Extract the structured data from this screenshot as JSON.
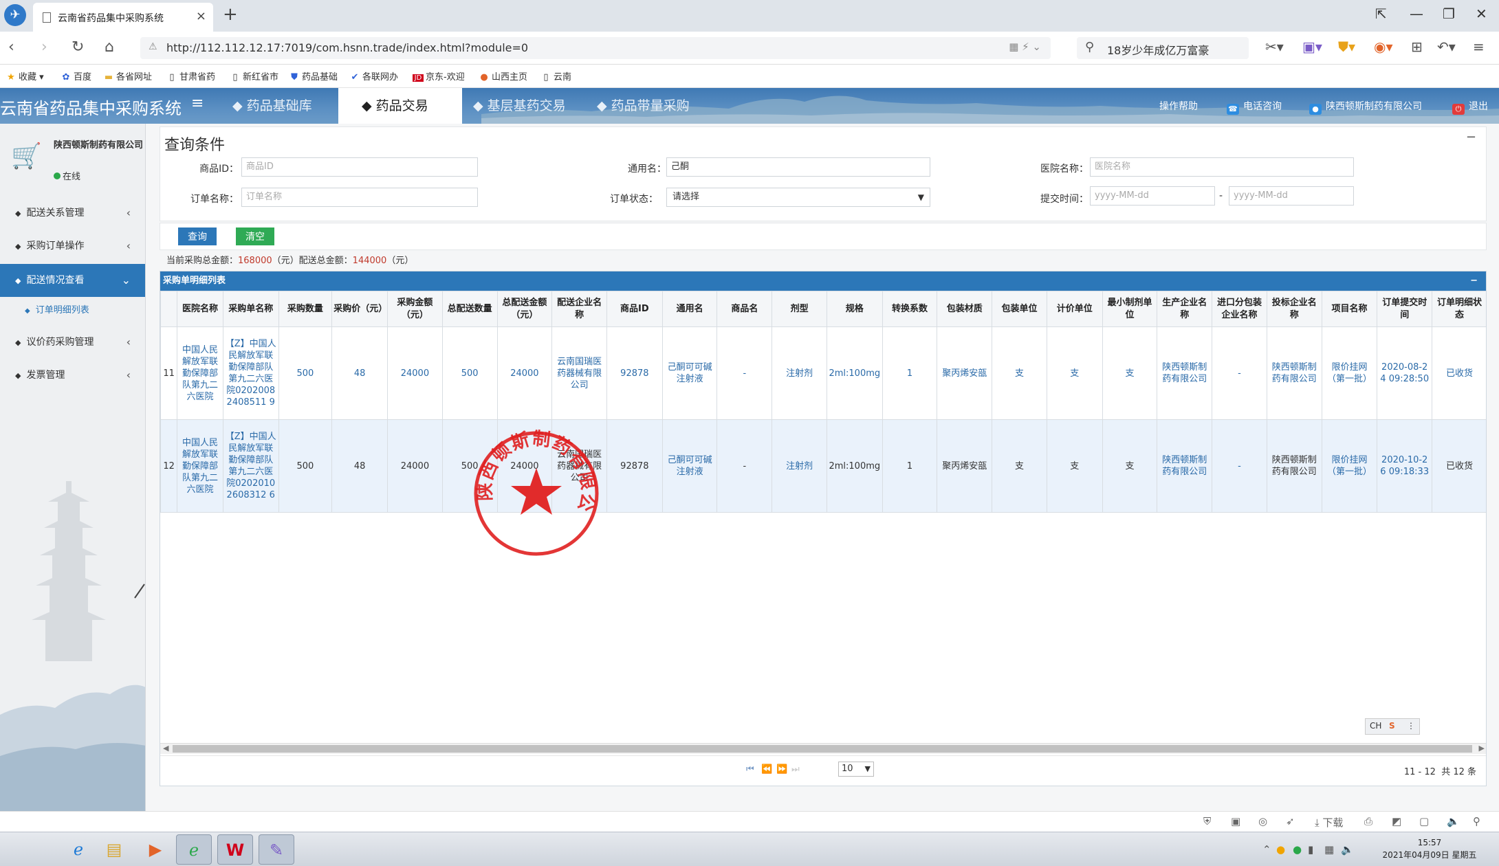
{
  "browser": {
    "tab_title": "云南省药品集中采购系统",
    "tab_close": "×",
    "new_tab": "+",
    "url": "http://112.112.12.17:7019/com.hsnn.trade/index.html?module=0",
    "search_text": "18岁少年成亿万富豪"
  },
  "bookmarks": [
    {
      "label": "收藏",
      "icon": "star-icon"
    },
    {
      "label": "百度",
      "icon": "paw-icon"
    },
    {
      "label": "各省网址",
      "icon": "folder-icon"
    },
    {
      "label": "甘肃省药",
      "icon": "page-icon"
    },
    {
      "label": "新红省市",
      "icon": "page-icon"
    },
    {
      "label": "药品基础",
      "icon": "shield-icon"
    },
    {
      "label": "各联网办",
      "icon": "check-icon"
    },
    {
      "label": "京东-欢迎",
      "icon": "jd-icon"
    },
    {
      "label": "山西主页",
      "icon": "dot-icon"
    },
    {
      "label": "云南",
      "icon": "page-icon"
    }
  ],
  "app": {
    "system_title": "云南省药品集中采购系统",
    "nav_tabs": [
      "药品基础库",
      "药品交易",
      "基层基药交易",
      "药品带量采购"
    ],
    "active_tab": 1,
    "help": "操作帮助",
    "phone": "电话咨询",
    "company": "陕西顿斯制药有限公司",
    "logout": "退出"
  },
  "sidebar": {
    "user_name": "陕西顿斯制药有限公司",
    "user_status": "在线",
    "items": [
      {
        "label": "配送关系管理",
        "active": false
      },
      {
        "label": "采购订单操作",
        "active": false
      },
      {
        "label": "配送情况查看",
        "active": true
      },
      {
        "label": "议价药采购管理",
        "active": false
      },
      {
        "label": "发票管理",
        "active": false
      }
    ],
    "sub_item": "订单明细列表"
  },
  "query": {
    "title": "查询条件",
    "collapse": "−",
    "product_id_label": "商品ID：",
    "product_id_placeholder": "商品ID",
    "generic_name_label": "通用名：",
    "generic_name_value": "己酮",
    "hospital_label": "医院名称：",
    "hospital_placeholder": "医院名称",
    "order_name_label": "订单名称：",
    "order_name_placeholder": "订单名称",
    "order_status_label": "订单状态：",
    "order_status_value": "请选择",
    "submit_time_label": "提交时间：",
    "date_placeholder": "yyyy-MM-dd",
    "date_sep": "-",
    "query_btn": "查询",
    "clear_btn": "清空"
  },
  "summary": {
    "prefix": "当前采购总金额：",
    "purchase_total": "168000",
    "unit1": "（元）配送总金额：",
    "delivery_total": "144000",
    "unit2": "（元）"
  },
  "grid": {
    "title": "采购单明细列表",
    "minimize": "−",
    "columns": [
      "",
      "医院名称",
      "采购单名称",
      "采购数量",
      "采购价（元）",
      "采购金额（元）",
      "总配送数量",
      "总配送金额（元）",
      "配送企业名称",
      "商品ID",
      "通用名",
      "商品名",
      "剂型",
      "规格",
      "转换系数",
      "包装材质",
      "包装单位",
      "计价单位",
      "最小制剂单位",
      "生产企业名称",
      "进口分包装企业名称",
      "投标企业名称",
      "项目名称",
      "订单提交时间",
      "订单明细状态"
    ],
    "rows": [
      [
        "11",
        "中国人民解放军联勤保障部队第九二六医院",
        "【Z】中国人民解放军联勤保障部队第九二六医院02020082408511 9",
        "500",
        "48",
        "24000",
        "500",
        "24000",
        "云南国瑞医药器械有限公司",
        "92878",
        "己酮可可碱注射液",
        "-",
        "注射剂",
        "2ml:100mg",
        "1",
        "聚丙烯安瓿",
        "支",
        "支",
        "支",
        "陕西顿斯制药有限公司",
        "-",
        "陕西顿斯制药有限公司",
        "限价挂网（第一批）",
        "2020-08-24 09:28:50",
        "已收货"
      ],
      [
        "12",
        "中国人民解放军联勤保障部队第九二六医院",
        "【Z】中国人民解放军联勤保障部队第九二六医院02020102608312 6",
        "500",
        "48",
        "24000",
        "500",
        "24000",
        "云南国瑞医药器械有限公司",
        "92878",
        "己酮可可碱注射液",
        "-",
        "注射剂",
        "2ml:100mg",
        "1",
        "聚丙烯安瓿",
        "支",
        "支",
        "支",
        "陕西顿斯制药有限公司",
        "-",
        "陕西顿斯制药有限公司",
        "限价挂网（第一批）",
        "2020-10-26 09:18:33",
        "已收货"
      ]
    ]
  },
  "stamp": {
    "text": "陕西顿斯制药有限公司",
    "color": "#e02020"
  },
  "ime": {
    "label": "CH"
  },
  "pager": {
    "page_size": "10",
    "range": "11 - 12",
    "total": "共 12 条"
  },
  "statusbar": {
    "download": "下载"
  },
  "taskbar": {
    "time": "15:57",
    "date": "2021年04月09日 星期五"
  }
}
